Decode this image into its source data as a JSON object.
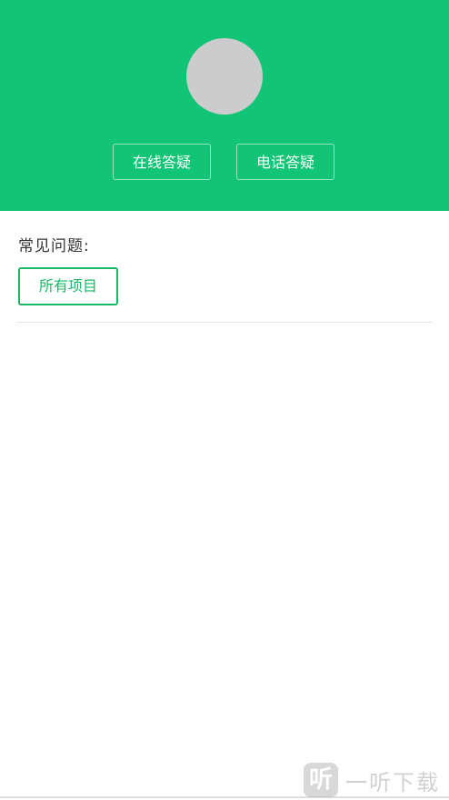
{
  "header": {
    "online_qa_label": "在线答疑",
    "phone_qa_label": "电话答疑"
  },
  "faq": {
    "title": "常见问题:",
    "filter_label": "所有项目"
  },
  "watermark": {
    "logo_glyph": "听",
    "text": "一听下载"
  },
  "colors": {
    "header_green": "#12c576",
    "accent_green": "#19b866",
    "avatar_gray": "#cccccc"
  }
}
